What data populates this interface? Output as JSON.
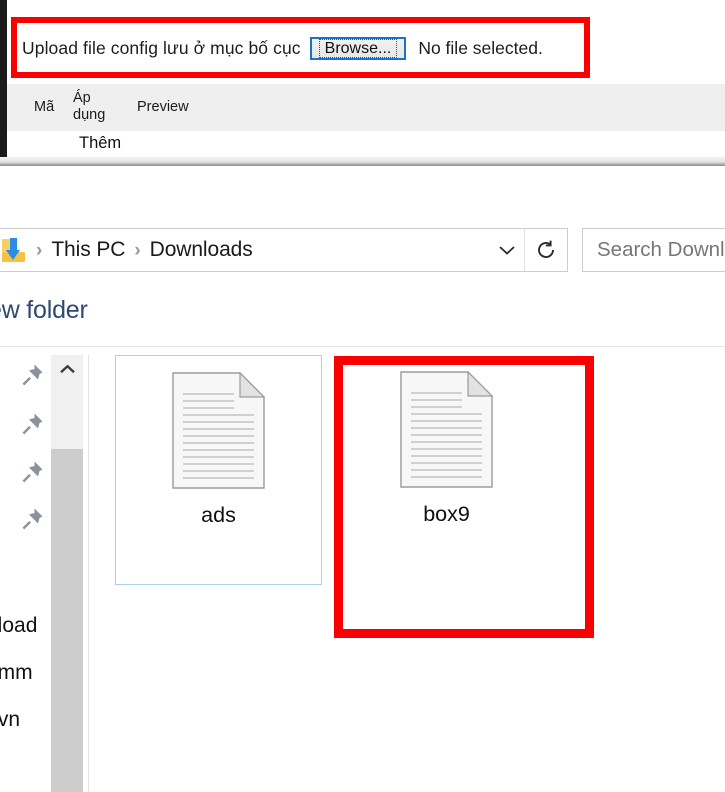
{
  "web_panel": {
    "upload_label": "Upload file config lưu ở mục bố cục",
    "browse_button": "Browse...",
    "file_status": "No file selected.",
    "table": {
      "headers": [
        "Mã",
        "Áp dụng",
        "Preview"
      ],
      "header_ma": "Mã",
      "header_apdung_line1": "Áp",
      "header_apdung_line2": "dụng",
      "header_preview": "Preview",
      "rows": [
        {
          "ma": "",
          "ap_dung": "Thêm",
          "preview": ""
        }
      ],
      "row1_them": "Thêm"
    }
  },
  "explorer": {
    "address_bar": {
      "location_icon": "downloads-folder-icon",
      "breadcrumbs": [
        "This PC",
        "Downloads"
      ],
      "crumb_this_pc": "This PC",
      "crumb_downloads": "Downloads",
      "separator": "›",
      "dropdown_icon": "chevron-down-icon",
      "refresh_icon": "refresh-icon"
    },
    "search": {
      "placeholder": "Search Downloads",
      "value": ""
    },
    "command_bar": {
      "new_folder_label": "ew folder",
      "new_folder_full": "New folder"
    },
    "nav_pane": {
      "pin_count": 4,
      "pin_icon": "pushpin-icon",
      "items": [
        {
          "label": ""
        },
        {
          "label": ""
        },
        {
          "label": ""
        },
        {
          "label": ""
        },
        {
          "label": "pload"
        },
        {
          "label": "omm"
        },
        {
          "label": ".vn"
        }
      ],
      "text_items": [
        {
          "label": "pload"
        },
        {
          "label": "omm"
        },
        {
          "label": ".vn"
        }
      ],
      "scrollbar": {
        "up_arrow_icon": "chevron-up-icon"
      }
    },
    "files": [
      {
        "name": "ads",
        "icon": "text-document-icon",
        "selected": true
      },
      {
        "name": "box9",
        "icon": "text-document-icon",
        "selected": false
      }
    ]
  },
  "annotations": {
    "color": "#fb0000",
    "boxes": [
      {
        "target": "upload-row"
      },
      {
        "target": "file-box9"
      }
    ]
  }
}
